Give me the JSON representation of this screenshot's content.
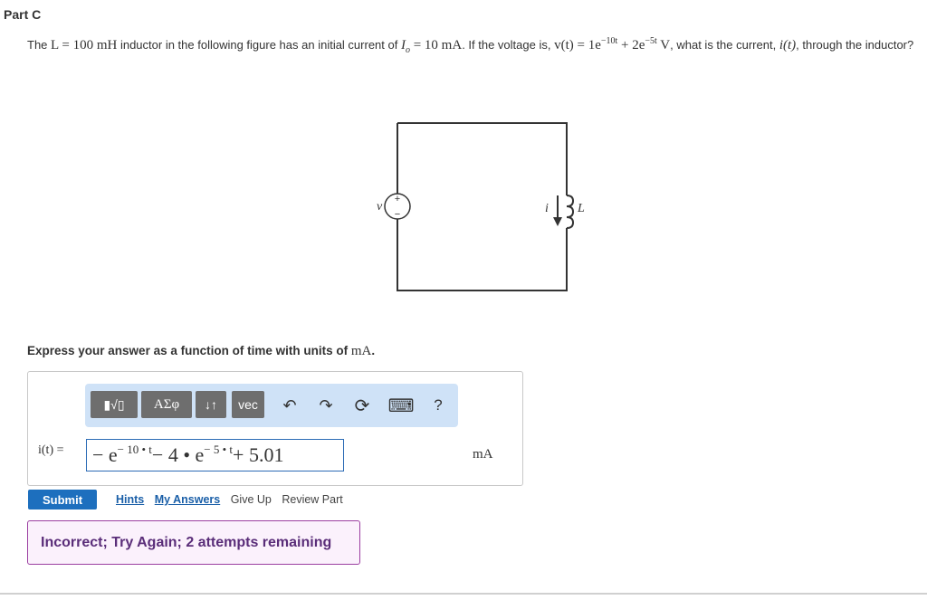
{
  "part": {
    "title": "Part C"
  },
  "problem": {
    "t1": "The ",
    "m_L": "L = 100 mH",
    "t2": " inductor in the following figure has an initial current of ",
    "m_Io": "I",
    "m_Io_sub": "o",
    "m_Io_val": " = 10 mA",
    "t3": ". If the voltage is, ",
    "m_v": "v(t) = 1e",
    "m_v_exp1": "−10t",
    "m_v_mid": " + 2e",
    "m_v_exp2": "−5t",
    "m_v_unit": " V",
    "t4": ", what is the current, ",
    "m_i": "i(t)",
    "t5": ", through the inductor?"
  },
  "circuit": {
    "v_label": "v",
    "plus": "+",
    "minus": "−",
    "i_label": "i",
    "L_label": "L"
  },
  "instruction": {
    "text": "Express your answer as a function of time with units of ",
    "unit": "mA",
    "end": "."
  },
  "toolbar": {
    "templates": "▮√▯",
    "greek": "ΑΣφ",
    "arrows": "↓↑",
    "vec": "vec",
    "undo": "↶",
    "redo": "↷",
    "reset": "⟳",
    "keyboard": "⌨",
    "help": "?"
  },
  "answer": {
    "label": "i(t) =",
    "p1": "− e",
    "exp1": "− 10 • t",
    "p2": " − 4 • e",
    "exp2": "− 5 • t",
    "p3": " + 5.01",
    "units": "mA"
  },
  "actions": {
    "submit": "Submit",
    "hints": "Hints",
    "my_answers": "My Answers",
    "give_up": "Give Up",
    "review_part": "Review Part"
  },
  "feedback": {
    "text": "Incorrect; Try Again; 2 attempts remaining"
  }
}
